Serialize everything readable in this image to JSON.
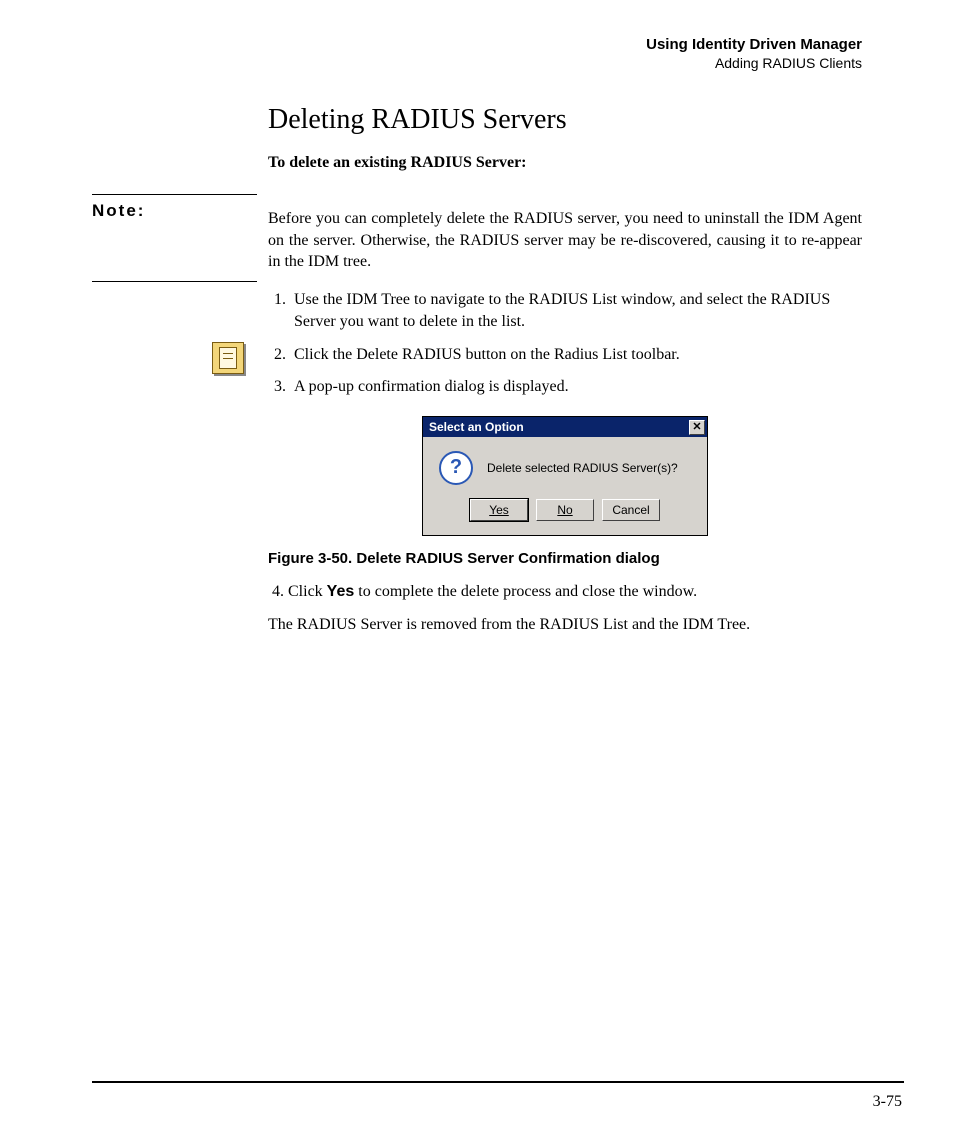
{
  "header": {
    "chapter": "Using Identity Driven Manager",
    "section": "Adding RADIUS Clients"
  },
  "title": "Deleting RADIUS Servers",
  "lead": "To delete an existing RADIUS Server:",
  "note_label": "Note:",
  "note_body": "Before you can completely delete the RADIUS server, you need to uninstall the IDM Agent on the server. Otherwise, the RADIUS server may be re-discovered, causing it to re-appear in the IDM tree.",
  "steps": [
    "Use the IDM Tree to navigate to the RADIUS List window, and select the RADIUS Server you want to delete in the list.",
    "Click the Delete RADIUS button on the Radius List toolbar.",
    "A pop-up confirmation dialog is displayed."
  ],
  "dialog": {
    "title": "Select an Option",
    "message": "Delete selected RADIUS Server(s)?",
    "buttons": {
      "yes": "Yes",
      "no": "No",
      "cancel": "Cancel"
    },
    "close_glyph": "✕"
  },
  "figure_caption": "Figure 3-50. Delete RADIUS Server Confirmation dialog",
  "step4_prefix": "4.   Click ",
  "step4_bold": "Yes",
  "step4_suffix": " to complete the delete process and close the window.",
  "closing": "The RADIUS Server is removed from the RADIUS List and the IDM Tree.",
  "page_number": "3-75",
  "q_glyph": "?"
}
